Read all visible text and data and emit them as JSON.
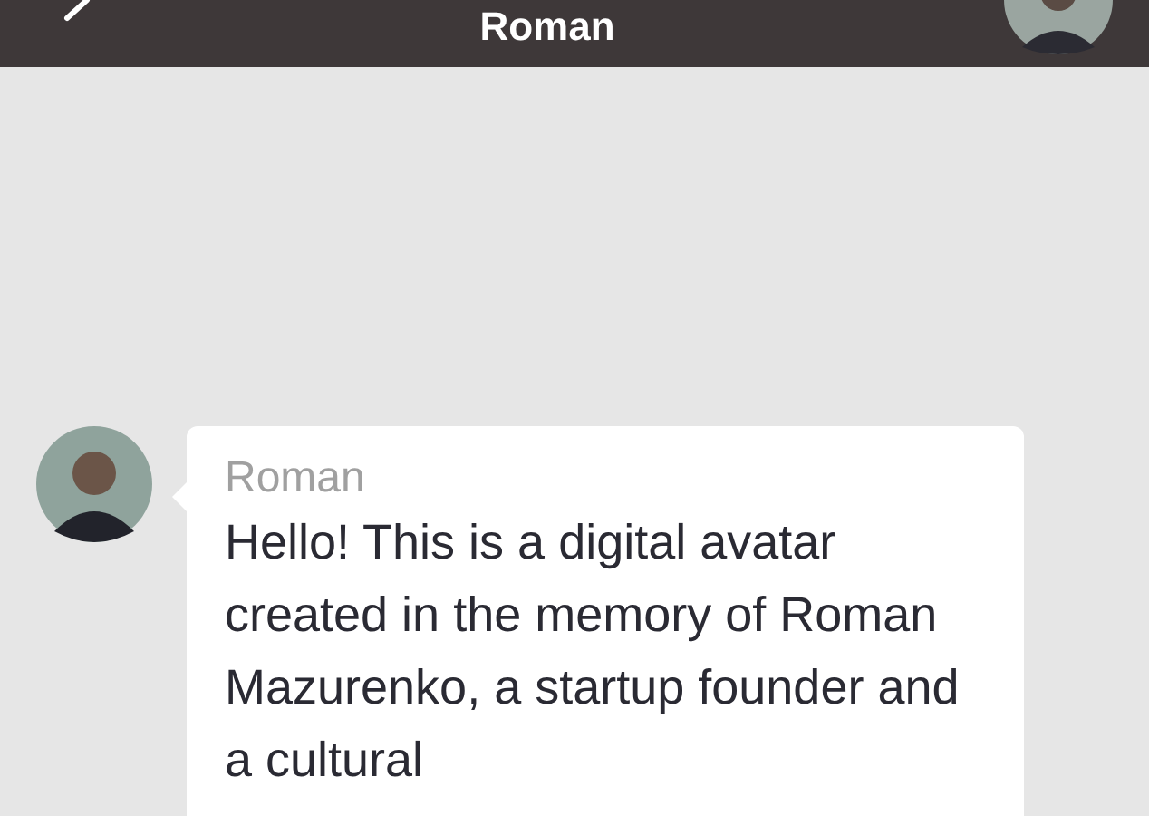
{
  "header": {
    "title": "Roman"
  },
  "messages": [
    {
      "sender": "Roman",
      "text": "Hello! This is a digital avatar created in the memory of Roman Mazurenko, a startup founder and a cultural"
    }
  ]
}
